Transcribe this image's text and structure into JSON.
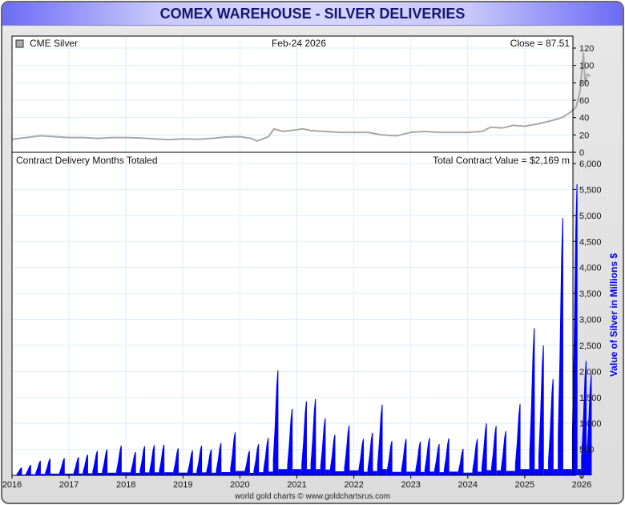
{
  "title": "COMEX WAREHOUSE - SILVER DELIVERIES",
  "footer": "world gold charts © www.goldchartsrus.com",
  "colors": {
    "price": "#a8a8a8",
    "bars": "#0000ff",
    "axis_label": "#0000ee",
    "grid": "#ddeef8"
  },
  "chart_data": [
    {
      "type": "line",
      "legend": "CME Silver",
      "date_label": "Feb-24  2026",
      "close_label": "Close = 87.51",
      "ylim": [
        0,
        120
      ],
      "yticks": [
        0,
        20,
        40,
        60,
        80,
        100,
        120
      ],
      "x": [
        2016.0,
        2016.25,
        2016.5,
        2016.75,
        2017.0,
        2017.25,
        2017.5,
        2017.75,
        2018.0,
        2018.25,
        2018.5,
        2018.75,
        2019.0,
        2019.25,
        2019.5,
        2019.75,
        2020.0,
        2020.2,
        2020.3,
        2020.5,
        2020.6,
        2020.75,
        2021.0,
        2021.1,
        2021.25,
        2021.5,
        2021.75,
        2022.0,
        2022.25,
        2022.5,
        2022.75,
        2023.0,
        2023.25,
        2023.5,
        2023.75,
        2024.0,
        2024.25,
        2024.4,
        2024.6,
        2024.8,
        2025.0,
        2025.25,
        2025.5,
        2025.65,
        2025.8,
        2025.9,
        2025.97,
        2026.03,
        2026.06,
        2026.1,
        2026.15
      ],
      "y": [
        15,
        17,
        19,
        18,
        17,
        17,
        16,
        17,
        17,
        16.5,
        15.5,
        14.5,
        15.5,
        15,
        16,
        17.5,
        18,
        16,
        13,
        18,
        27,
        24,
        26,
        27,
        25,
        24,
        23,
        23,
        23,
        20,
        19,
        23,
        24,
        23,
        23,
        23,
        24,
        29,
        28,
        31,
        30,
        33,
        37,
        40,
        46,
        52,
        70,
        115,
        78,
        90,
        87.51
      ]
    },
    {
      "type": "bar",
      "title": "Contract Delivery Months Totaled",
      "total_label": "Total Contract Value = $2,169 m",
      "ylabel": "Value of Silver in Millions $",
      "ylim": [
        0,
        6000
      ],
      "yticks": [
        "0",
        "500",
        "1,000",
        "1,500",
        "2,000",
        "2,500",
        "3,000",
        "3,500",
        "4,000",
        "4,500",
        "5,000",
        "5,500",
        "6,000"
      ],
      "xticks": [
        "2016",
        "2017",
        "2018",
        "2019",
        "2020",
        "2021",
        "2022",
        "2023",
        "2024",
        "2025",
        "2026"
      ],
      "delivery_months": [
        2016.17,
        2016.33,
        2016.5,
        2016.67,
        2016.92,
        2017.17,
        2017.33,
        2017.5,
        2017.67,
        2017.92,
        2018.17,
        2018.33,
        2018.5,
        2018.67,
        2018.92,
        2019.17,
        2019.33,
        2019.5,
        2019.67,
        2019.92,
        2020.17,
        2020.33,
        2020.5,
        2020.67,
        2020.92,
        2021.17,
        2021.33,
        2021.5,
        2021.67,
        2021.92,
        2022.17,
        2022.33,
        2022.5,
        2022.67,
        2022.92,
        2023.17,
        2023.33,
        2023.5,
        2023.67,
        2023.92,
        2024.17,
        2024.33,
        2024.5,
        2024.67,
        2024.92,
        2025.17,
        2025.33,
        2025.5,
        2025.67,
        2025.92,
        2026.08,
        2026.17
      ],
      "values": [
        150,
        200,
        280,
        320,
        330,
        350,
        400,
        470,
        500,
        570,
        450,
        560,
        580,
        590,
        520,
        480,
        570,
        500,
        620,
        830,
        470,
        600,
        720,
        2020,
        1280,
        1420,
        1470,
        1100,
        780,
        960,
        700,
        820,
        1360,
        660,
        700,
        650,
        720,
        600,
        710,
        510,
        700,
        1000,
        950,
        850,
        1370,
        2830,
        2500,
        1850,
        4950,
        5600,
        2200,
        1950
      ]
    }
  ]
}
